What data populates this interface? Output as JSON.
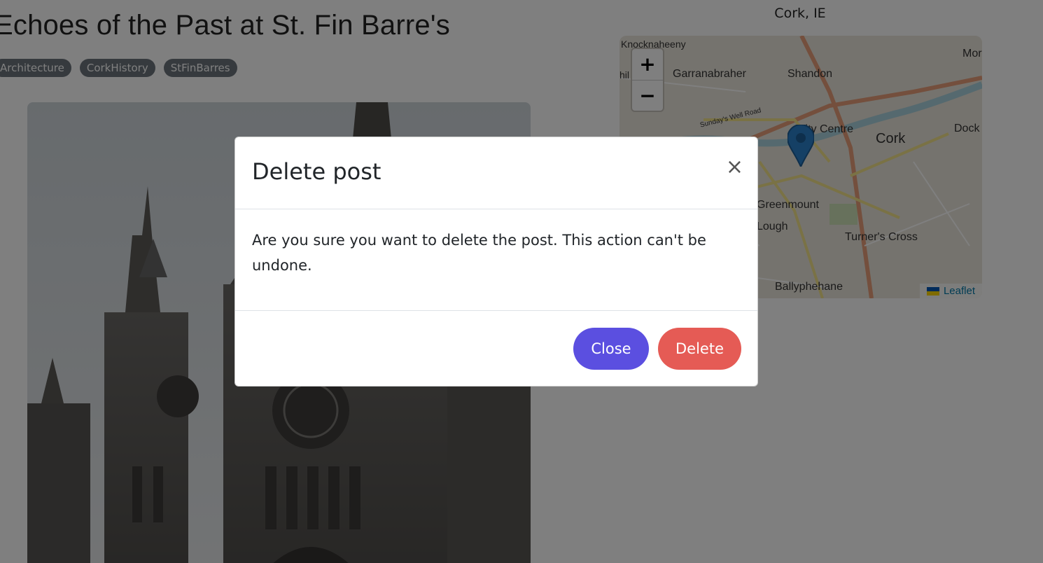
{
  "post": {
    "title": "Echoes of the Past at St. Fin Barre's",
    "tags": [
      "Architecture",
      "CorkHistory",
      "StFinBarres"
    ],
    "location": "Cork, IE"
  },
  "map": {
    "zoom_in": "+",
    "zoom_out": "−",
    "attribution": "Leaflet",
    "labels": {
      "knocknaheeny": "Knocknaheeny",
      "garranabraher": "Garranabraher",
      "shandon": "Shandon",
      "city_centre": "City Centre",
      "cork": "Cork",
      "docks": "Dock",
      "mo": "Mor",
      "greenmount": "Greenmount",
      "lough": "Lough",
      "turners_cross": "Turner's Cross",
      "ballyphehane": "Ballyphehane",
      "sundays_well": "Sunday's Well Road",
      "hil": "hil"
    }
  },
  "modal": {
    "title": "Delete post",
    "close_symbol": "×",
    "body": "Are you sure you want to delete the post. This action can't be undone.",
    "close_label": "Close",
    "delete_label": "Delete"
  },
  "colors": {
    "primary": "#5b4fe0",
    "danger": "#e55b55",
    "tag": "#6c757d"
  }
}
